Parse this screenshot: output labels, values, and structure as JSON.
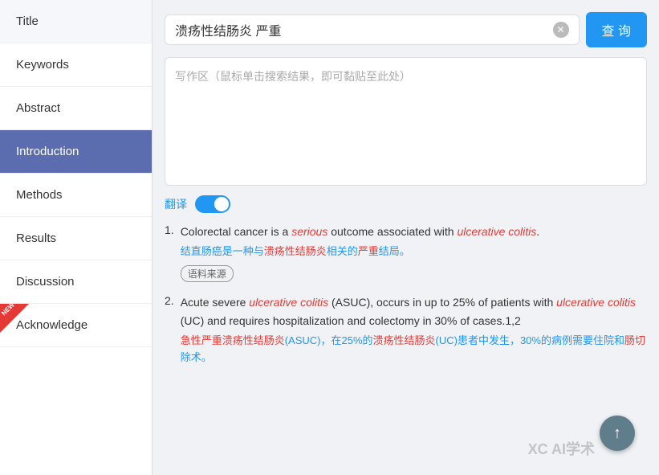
{
  "sidebar": {
    "items": [
      {
        "id": "title",
        "label": "Title",
        "active": false,
        "new": false
      },
      {
        "id": "keywords",
        "label": "Keywords",
        "active": false,
        "new": false
      },
      {
        "id": "abstract",
        "label": "Abstract",
        "active": false,
        "new": false
      },
      {
        "id": "introduction",
        "label": "Introduction",
        "active": true,
        "new": false
      },
      {
        "id": "methods",
        "label": "Methods",
        "active": false,
        "new": false
      },
      {
        "id": "results",
        "label": "Results",
        "active": false,
        "new": false
      },
      {
        "id": "discussion",
        "label": "Discussion",
        "active": false,
        "new": false
      },
      {
        "id": "acknowledge",
        "label": "Acknowledge",
        "active": false,
        "new": true
      }
    ]
  },
  "search": {
    "query": "溃疡性结肠炎 严重",
    "button_label": "查 询",
    "clear_title": "clear"
  },
  "writing_area": {
    "placeholder": "写作区（鼠标单击搜索结果，即可黏贴至此处）"
  },
  "translate": {
    "label": "翻译",
    "enabled": true
  },
  "results": [
    {
      "number": "1.",
      "en_parts": [
        {
          "text": "Colorectal cancer is a ",
          "style": "normal"
        },
        {
          "text": "serious",
          "style": "italic-red"
        },
        {
          "text": " outcome associated with ",
          "style": "normal"
        },
        {
          "text": "ulcerative colitis",
          "style": "italic-red"
        },
        {
          "text": ".",
          "style": "normal"
        }
      ],
      "zh": "结直肠癌是一种与溃疡性结肠炎相关的严重结局。",
      "zh_highlights": [
        {
          "text": "溃疡性结肠炎",
          "style": "red"
        },
        {
          "text": "严重",
          "style": "red"
        }
      ],
      "source_tag": "语料来源"
    },
    {
      "number": "2.",
      "en_parts": [
        {
          "text": "Acute severe ",
          "style": "normal"
        },
        {
          "text": "ulcerative colitis",
          "style": "italic-red"
        },
        {
          "text": " (ASUC), occurs in up to 25% of patients with ",
          "style": "normal"
        },
        {
          "text": "ulcerative colitis",
          "style": "italic-red"
        },
        {
          "text": " (UC) and requires hospitalization and colectomy in 30% of cases.1,2",
          "style": "normal"
        }
      ],
      "zh": "急性严重溃疡性结肠炎(ASUC)，在25%的溃疡性结肠炎(UC)患者中发生，30%的病例需要住院和肠切除术。",
      "zh_highlights": [
        {
          "text": "急性严重",
          "style": "red"
        },
        {
          "text": "溃疡性结肠炎",
          "style": "red"
        }
      ],
      "source_tag": null
    }
  ],
  "scroll_up": "↑",
  "watermark": "XC AI学术"
}
